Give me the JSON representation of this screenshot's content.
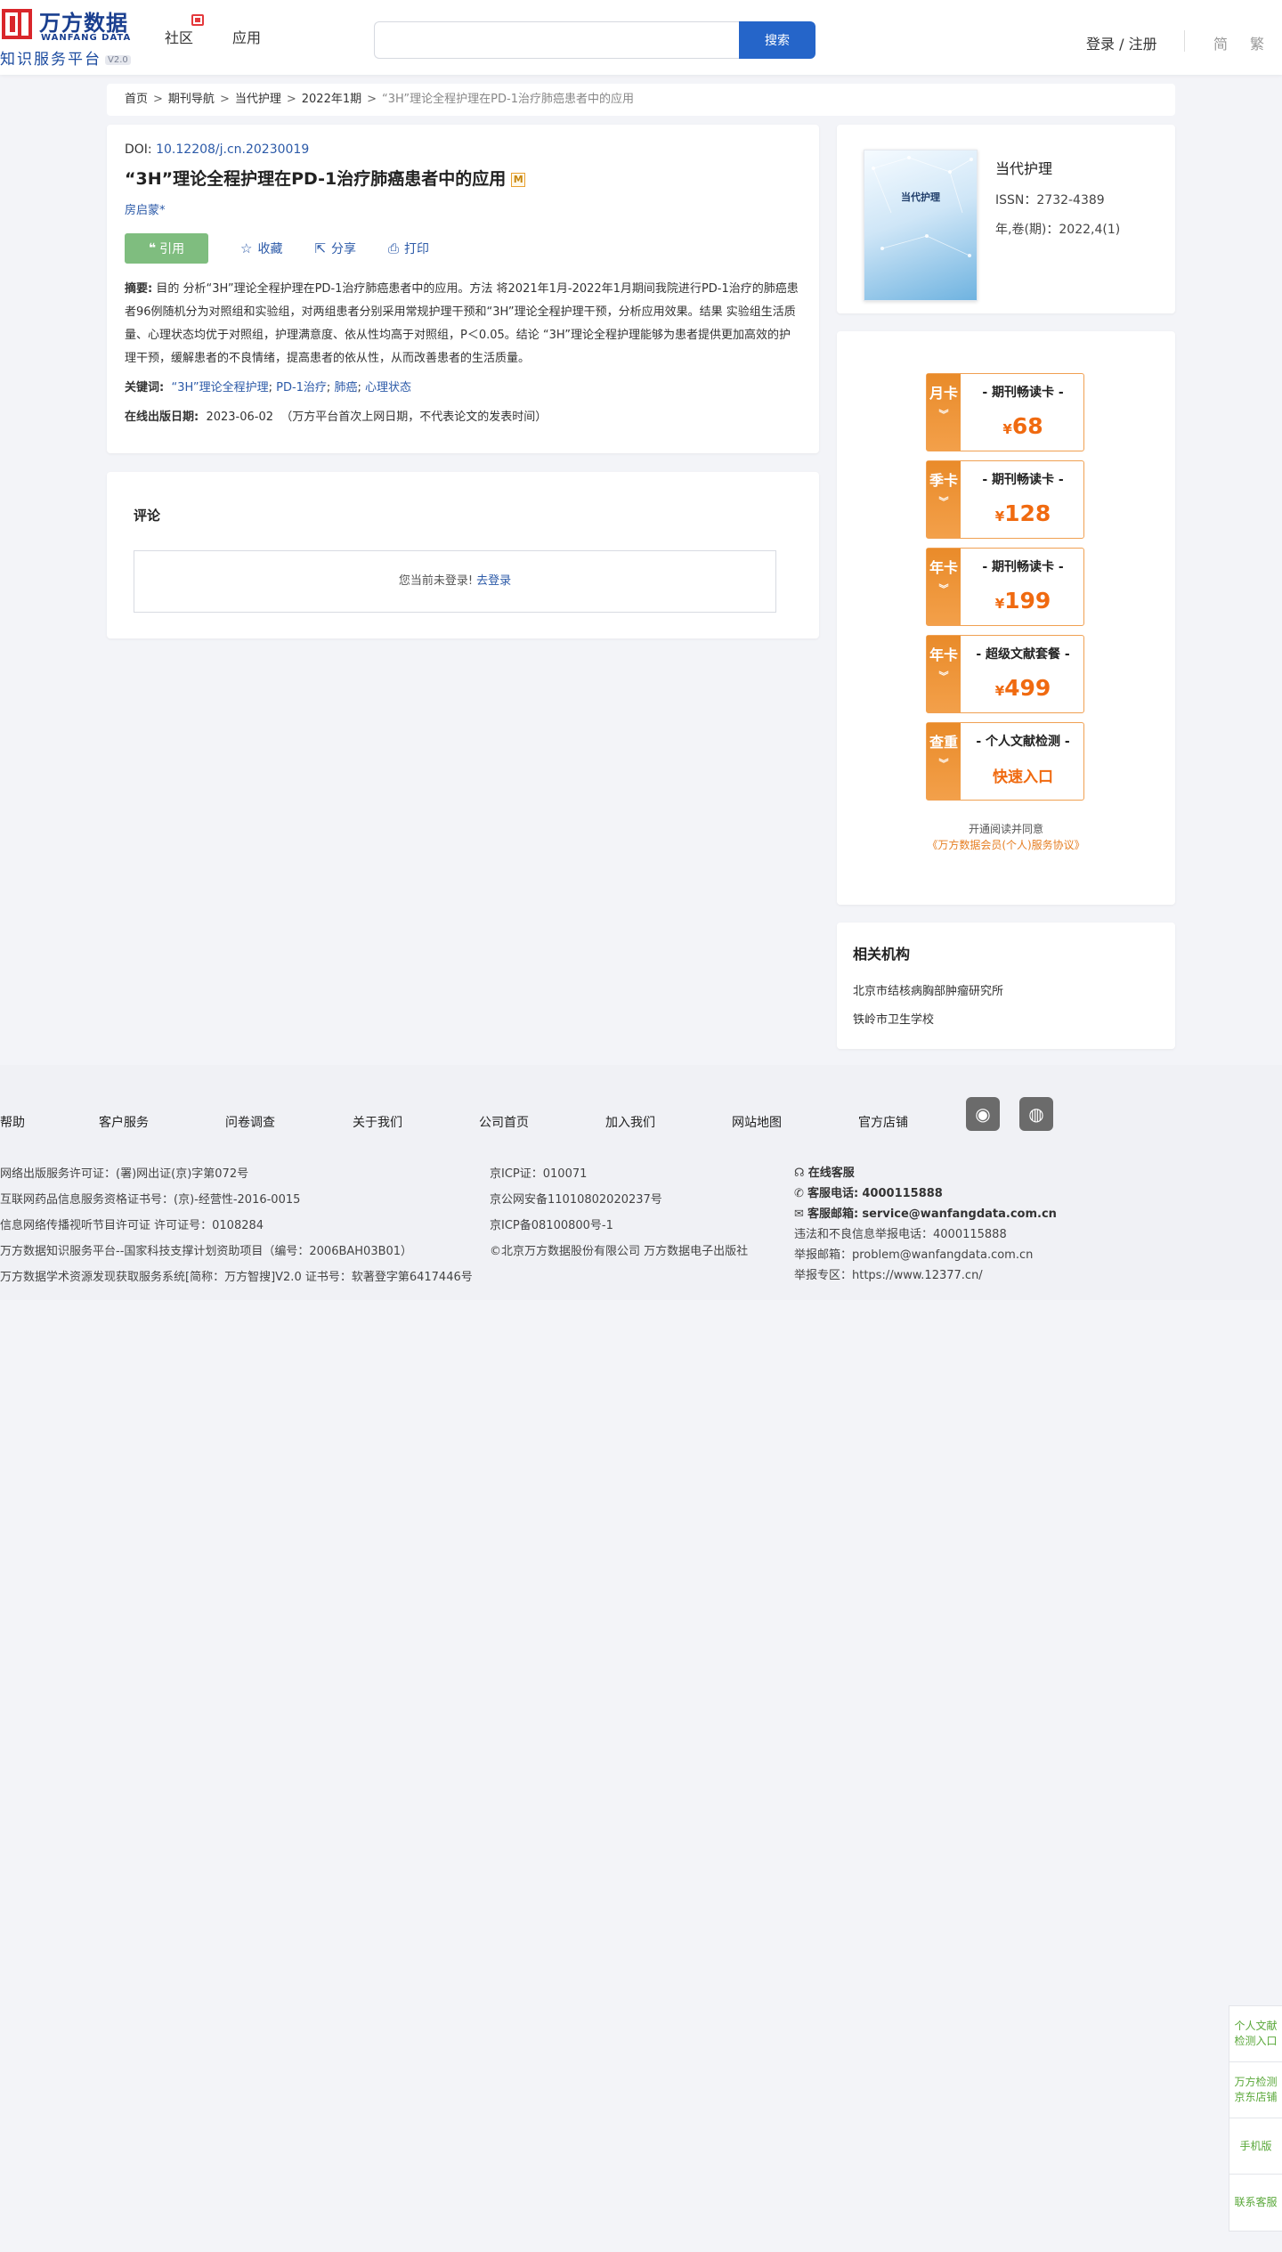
{
  "header": {
    "logo_cn": "万方数据",
    "logo_en": "WANFANG DATA",
    "logo_sub": "知识服务平台",
    "logo_version": "V2.0",
    "nav": [
      "社区",
      "应用"
    ],
    "search_placeholder": "",
    "search_button": "搜索",
    "login": "登录 / 注册",
    "lang_simplified": "简",
    "lang_traditional": "繁"
  },
  "breadcrumb": {
    "items": [
      "首页",
      "期刊导航",
      "当代护理",
      "2022年1期"
    ],
    "separator": ">",
    "current": "“3H”理论全程护理在PD-1治疗肺癌患者中的应用"
  },
  "article": {
    "doi_label": "DOI:",
    "doi": "10.12208/j.cn.20230019",
    "title": "“3H”理论全程护理在PD-1治疗肺癌患者中的应用",
    "title_badge": "M",
    "author": "房启蒙*",
    "actions": {
      "cite": "引用",
      "collect": "收藏",
      "share": "分享",
      "print": "打印"
    },
    "abstract_label": "摘要:",
    "abstract": "目的 分析“3H”理论全程护理在PD-1治疗肺癌患者中的应用。方法 将2021年1月-2022年1月期间我院进行PD-1治疗的肺癌患者96例随机分为对照组和实验组，对两组患者分别采用常规护理干预和“3H”理论全程护理干预，分析应用效果。结果 实验组生活质量、心理状态均优于对照组，护理满意度、依从性均高于对照组，P＜0.05。结论 “3H”理论全程护理能够为患者提供更加高效的护理干预，缓解患者的不良情绪，提高患者的依从性，从而改善患者的生活质量。",
    "keywords_label": "关键词:",
    "keywords": [
      "“3H”理论全程护理",
      "PD-1治疗",
      "肺癌",
      "心理状态"
    ],
    "pubdate_label": "在线出版日期:",
    "pubdate": "2023-06-02",
    "pubdate_note": "（万方平台首次上网日期，不代表论文的发表时间）"
  },
  "comment": {
    "heading": "评论",
    "not_logged": "您当前未登录!",
    "login_link": "去登录"
  },
  "journal": {
    "cover_title": "当代护理",
    "name": "当代护理",
    "issn": "ISSN：2732-4389",
    "volume": "年,卷(期)：2022,4(1)"
  },
  "plans": [
    {
      "side": "月卡",
      "name": "- 期刊畅读卡 -",
      "currency": "¥",
      "price": "68"
    },
    {
      "side": "季卡",
      "name": "- 期刊畅读卡 -",
      "currency": "¥",
      "price": "128"
    },
    {
      "side": "年卡",
      "name": "- 期刊畅读卡 -",
      "currency": "¥",
      "price": "199"
    },
    {
      "side": "年卡",
      "name": "- 超级文献套餐 -",
      "currency": "¥",
      "price": "499"
    },
    {
      "side": "查重",
      "name": "- 个人文献检测 -",
      "link": "快速入口"
    }
  ],
  "agreement": {
    "line1": "开通阅读并同意",
    "line2": "《万方数据会员(个人)服务协议》"
  },
  "institutions": {
    "heading": "相关机构",
    "items": [
      "北京市结核病胸部肿瘤研究所",
      "铁岭市卫生学校"
    ]
  },
  "footer": {
    "links": [
      "帮助",
      "客户服务",
      "问卷调查",
      "关于我们",
      "公司首页",
      "加入我们",
      "网站地图",
      "官方店铺"
    ],
    "col1": [
      "网络出版服务许可证：(署)网出证(京)字第072号",
      "互联网药品信息服务资格证书号：(京)-经营性-2016-0015",
      "信息网络传播视听节目许可证 许可证号：0108284",
      "万方数据知识服务平台--国家科技支撑计划资助项目（编号：2006BAH03B01）",
      "万方数据学术资源发现获取服务系统[简称：万方智搜]V2.0 证书号：软著登字第6417446号"
    ],
    "col2": [
      "京ICP证：010071",
      "京公网安备11010802020237号",
      "京ICP备08100800号-1",
      "©北京万方数据股份有限公司 万方数据电子出版社"
    ],
    "online_service": "在线客服",
    "phone_label": "客服电话:",
    "phone": "4000115888",
    "email_label": "客服邮箱:",
    "email": "service@wanfangdata.com.cn",
    "col3": [
      "违法和不良信息举报电话：4000115888",
      "举报邮箱：problem@wanfangdata.com.cn",
      "举报专区：https://www.12377.cn/"
    ]
  },
  "side_float": [
    "个人文献检测入口",
    "万方检测京东店铺",
    "手机版",
    "联系客服"
  ]
}
